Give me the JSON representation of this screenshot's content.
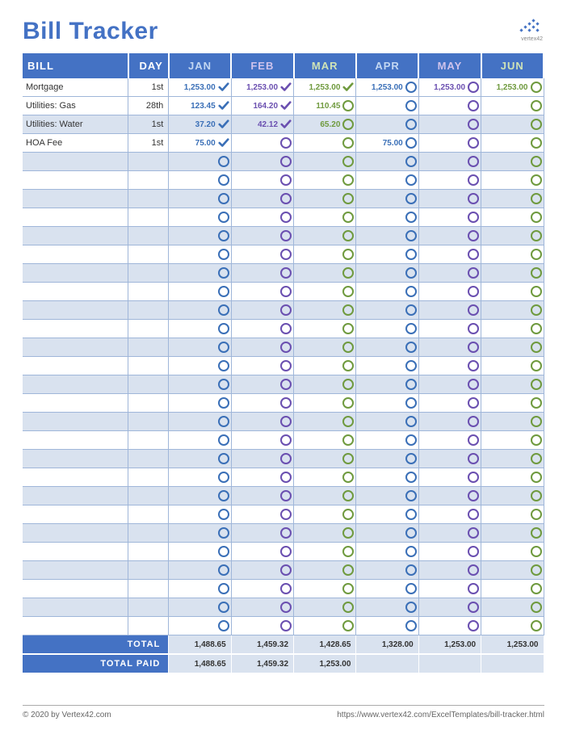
{
  "title": "Bill Tracker",
  "brand": "vertex42",
  "headers": {
    "bill": "BILL",
    "day": "DAY",
    "months": [
      "JAN",
      "FEB",
      "MAR",
      "APR",
      "MAY",
      "JUN"
    ]
  },
  "month_colors": [
    "#3a6fb7",
    "#6a4fb0",
    "#6f9a3e",
    "#3a6fb7",
    "#6a4fb0",
    "#6f9a3e"
  ],
  "rows": [
    {
      "bill": "Mortgage",
      "day": "1st",
      "cells": [
        {
          "v": "1,253.00",
          "s": "check"
        },
        {
          "v": "1,253.00",
          "s": "check"
        },
        {
          "v": "1,253.00",
          "s": "check"
        },
        {
          "v": "1,253.00",
          "s": "open"
        },
        {
          "v": "1,253.00",
          "s": "open"
        },
        {
          "v": "1,253.00",
          "s": "open"
        }
      ]
    },
    {
      "bill": "Utilities: Gas",
      "day": "28th",
      "cells": [
        {
          "v": "123.45",
          "s": "check"
        },
        {
          "v": "164.20",
          "s": "check"
        },
        {
          "v": "110.45",
          "s": "open"
        },
        {
          "v": "",
          "s": "open"
        },
        {
          "v": "",
          "s": "open"
        },
        {
          "v": "",
          "s": "open"
        }
      ]
    },
    {
      "bill": "Utilities: Water",
      "day": "1st",
      "cells": [
        {
          "v": "37.20",
          "s": "check"
        },
        {
          "v": "42.12",
          "s": "check"
        },
        {
          "v": "65.20",
          "s": "open"
        },
        {
          "v": "",
          "s": "open"
        },
        {
          "v": "",
          "s": "open"
        },
        {
          "v": "",
          "s": "open"
        }
      ]
    },
    {
      "bill": "HOA Fee",
      "day": "1st",
      "cells": [
        {
          "v": "75.00",
          "s": "check"
        },
        {
          "v": "",
          "s": "open"
        },
        {
          "v": "",
          "s": "open"
        },
        {
          "v": "75.00",
          "s": "open"
        },
        {
          "v": "",
          "s": "open"
        },
        {
          "v": "",
          "s": "open"
        }
      ]
    }
  ],
  "empty_row_count": 26,
  "totals": {
    "label_total": "TOTAL",
    "label_paid": "TOTAL PAID",
    "total": [
      "1,488.65",
      "1,459.32",
      "1,428.65",
      "1,328.00",
      "1,253.00",
      "1,253.00"
    ],
    "paid": [
      "1,488.65",
      "1,459.32",
      "1,253.00",
      "",
      "",
      ""
    ]
  },
  "footer": {
    "left": "© 2020 by Vertex42.com",
    "right": "https://www.vertex42.com/ExcelTemplates/bill-tracker.html"
  }
}
